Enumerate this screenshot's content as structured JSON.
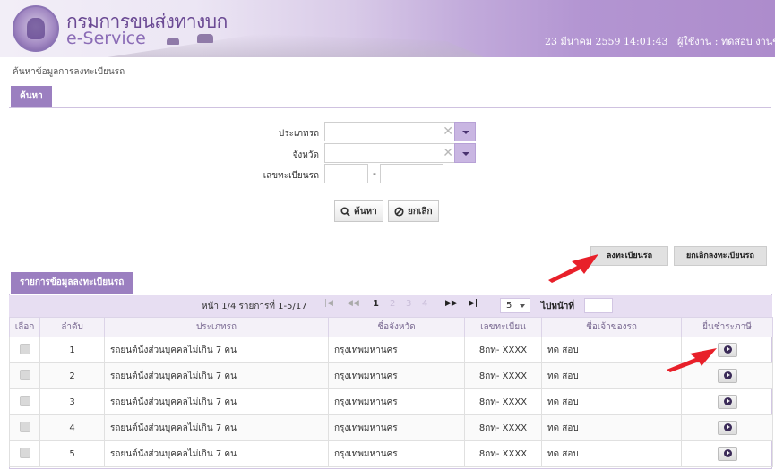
{
  "header": {
    "org_name_th": "กรมการขนส่งทางบก",
    "service_name": "e-Service",
    "datetime": "23 มีนาคม 2559 14:01:43",
    "user_label": "ผู้ใช้งาน : ทดสอบ  งานขนส่ง"
  },
  "breadcrumb": "ค้นหาข้อมูลการลงทะเบียนรถ",
  "search": {
    "tab_label": "ค้นหา",
    "vehicle_type_label": "ประเภทรถ",
    "province_label": "จังหวัด",
    "plate_label": "เลขทะเบียนรถ",
    "plate_dash": "-",
    "search_button": "ค้นหา",
    "cancel_button": "ยกเลิก"
  },
  "actions": {
    "register_button": "ลงทะเบียนรถ",
    "unregister_button": "ยกเลิกลงทะเบียนรถ"
  },
  "results": {
    "tab_label": "รายการข้อมูลลงทะเบียนรถ",
    "pager_info": "หน้า 1/4 รายการที่ 1-5/17",
    "nav_first": "|◀",
    "nav_prev": "◀◀",
    "nav_next": "▶▶",
    "nav_last": "▶|",
    "pages": [
      "1",
      "2",
      "3",
      "4"
    ],
    "page_size": "5",
    "goto_label": "ไปหน้าที่",
    "columns": [
      "เลือก",
      "ลำดับ",
      "ประเภทรถ",
      "ชื่อจังหวัด",
      "เลขทะเบียน",
      "ชื่อเจ้าของรถ",
      "ยื่นชำระภาษี"
    ],
    "rows": [
      {
        "seq": "1",
        "type": "รถยนต์นั่งส่วนบุคคลไม่เกิน 7 คน",
        "province": "กรุงเทพมหานคร",
        "plate": "8กท- XXXX",
        "owner": "ทด สอบ"
      },
      {
        "seq": "2",
        "type": "รถยนต์นั่งส่วนบุคคลไม่เกิน 7 คน",
        "province": "กรุงเทพมหานคร",
        "plate": "8กท- XXXX",
        "owner": "ทด สอบ"
      },
      {
        "seq": "3",
        "type": "รถยนต์นั่งส่วนบุคคลไม่เกิน 7 คน",
        "province": "กรุงเทพมหานคร",
        "plate": "8กท- XXXX",
        "owner": "ทด สอบ"
      },
      {
        "seq": "4",
        "type": "รถยนต์นั่งส่วนบุคคลไม่เกิน 7 คน",
        "province": "กรุงเทพมหานคร",
        "plate": "8กท- XXXX",
        "owner": "ทด สอบ"
      },
      {
        "seq": "5",
        "type": "รถยนต์นั่งส่วนบุคคลไม่เกิน 7 คน",
        "province": "กรุงเทพมหานคร",
        "plate": "8กท- XXXX",
        "owner": "ทด สอบ"
      }
    ]
  },
  "colors": {
    "accent_purple": "#9b7fc0",
    "arrow_red": "#e8202a"
  }
}
